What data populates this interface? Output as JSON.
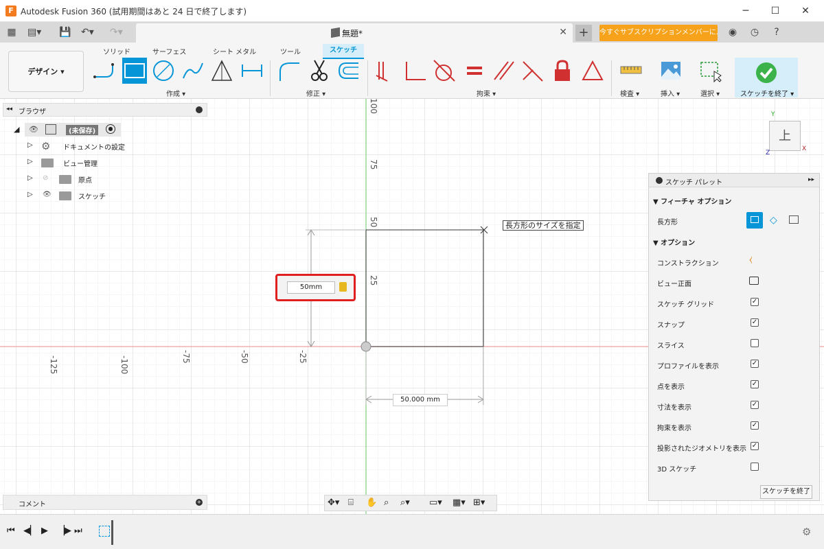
{
  "window": {
    "logo": "F",
    "title": "Autodesk Fusion 360 (試用期間はあと 24 日で終了します)",
    "controls": [
      "─",
      "☐",
      "✕"
    ]
  },
  "tabs": {
    "doc_title": "無題*",
    "close": "✕",
    "new_tab": "+",
    "subscription": "今すぐサブスクリプションメンバーに..."
  },
  "toolbar": {
    "workspace": "デザイン ▾",
    "ribbon_tabs": [
      "ソリッド",
      "サーフェス",
      "シート メタル",
      "ツール",
      "スケッチ"
    ],
    "groups": {
      "create": "作成 ▾",
      "modify": "修正 ▾",
      "constraints": "拘束 ▾",
      "inspect": "検査 ▾",
      "insert": "挿入 ▾",
      "select": "選択 ▾",
      "finish": "スケッチを終了 ▾"
    }
  },
  "browser": {
    "title": "ブラウザ",
    "root": "(未保存)",
    "items": [
      "ドキュメントの設定",
      "ビュー管理",
      "原点",
      "スケッチ"
    ]
  },
  "canvas": {
    "hint": "長方形のサイズを指定",
    "height_input": "50mm",
    "width_dim": "50.000 mm",
    "x_ticks": [
      "-125",
      "-100",
      "-75",
      "-50",
      "-25"
    ],
    "y_ticks": [
      "100",
      "75",
      "50",
      "25"
    ],
    "viewcube": "上",
    "axis_y": "Y",
    "axis_z": "Z",
    "axis_x": "X"
  },
  "palette": {
    "title": "スケッチ パレット",
    "section_feature": "フィーチャ オプション",
    "rect_label": "長方形",
    "section_options": "オプション",
    "options": [
      {
        "label": "コンストラクション",
        "kind": "icon"
      },
      {
        "label": "ビュー正面",
        "kind": "icon"
      },
      {
        "label": "スケッチ グリッド",
        "checked": true
      },
      {
        "label": "スナップ",
        "checked": true
      },
      {
        "label": "スライス",
        "checked": false
      },
      {
        "label": "プロファイルを表示",
        "checked": true
      },
      {
        "label": "点を表示",
        "checked": true
      },
      {
        "label": "寸法を表示",
        "checked": true
      },
      {
        "label": "拘束を表示",
        "checked": true
      },
      {
        "label": "投影されたジオメトリを表示",
        "checked": true
      },
      {
        "label": "3D スケッチ",
        "checked": false
      }
    ],
    "finish_button": "スケッチを終了"
  },
  "comments": {
    "title": "コメント"
  },
  "colors": {
    "accent": "#0696d7",
    "orange": "#f7a21b",
    "red_axis": "#e8a0a0",
    "green_axis": "#7fd07f",
    "highlight": "#e02020"
  }
}
